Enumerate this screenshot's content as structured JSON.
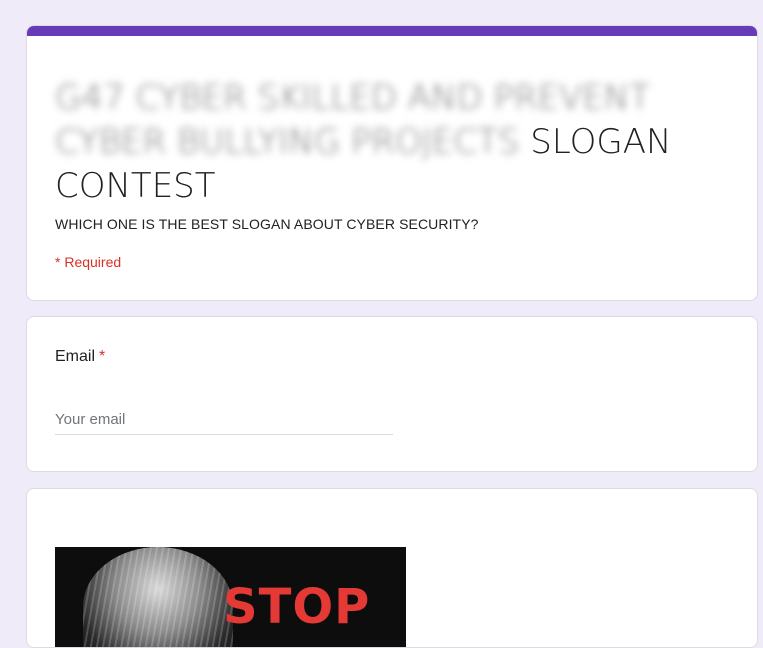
{
  "form": {
    "title_blurred": "G47 CYBER SKILLED AND PREVENT CYBER BULLYING PROJECTS",
    "title_visible": "SLOGAN CONTEST",
    "description": "WHICH ONE IS THE BEST SLOGAN ABOUT CYBER SECURITY?",
    "required_note": "* Required",
    "accent_color": "#673ab7"
  },
  "email": {
    "label": "Email",
    "required_star": "*",
    "placeholder": "Your email",
    "value": ""
  },
  "poster": {
    "text": "STOP"
  }
}
